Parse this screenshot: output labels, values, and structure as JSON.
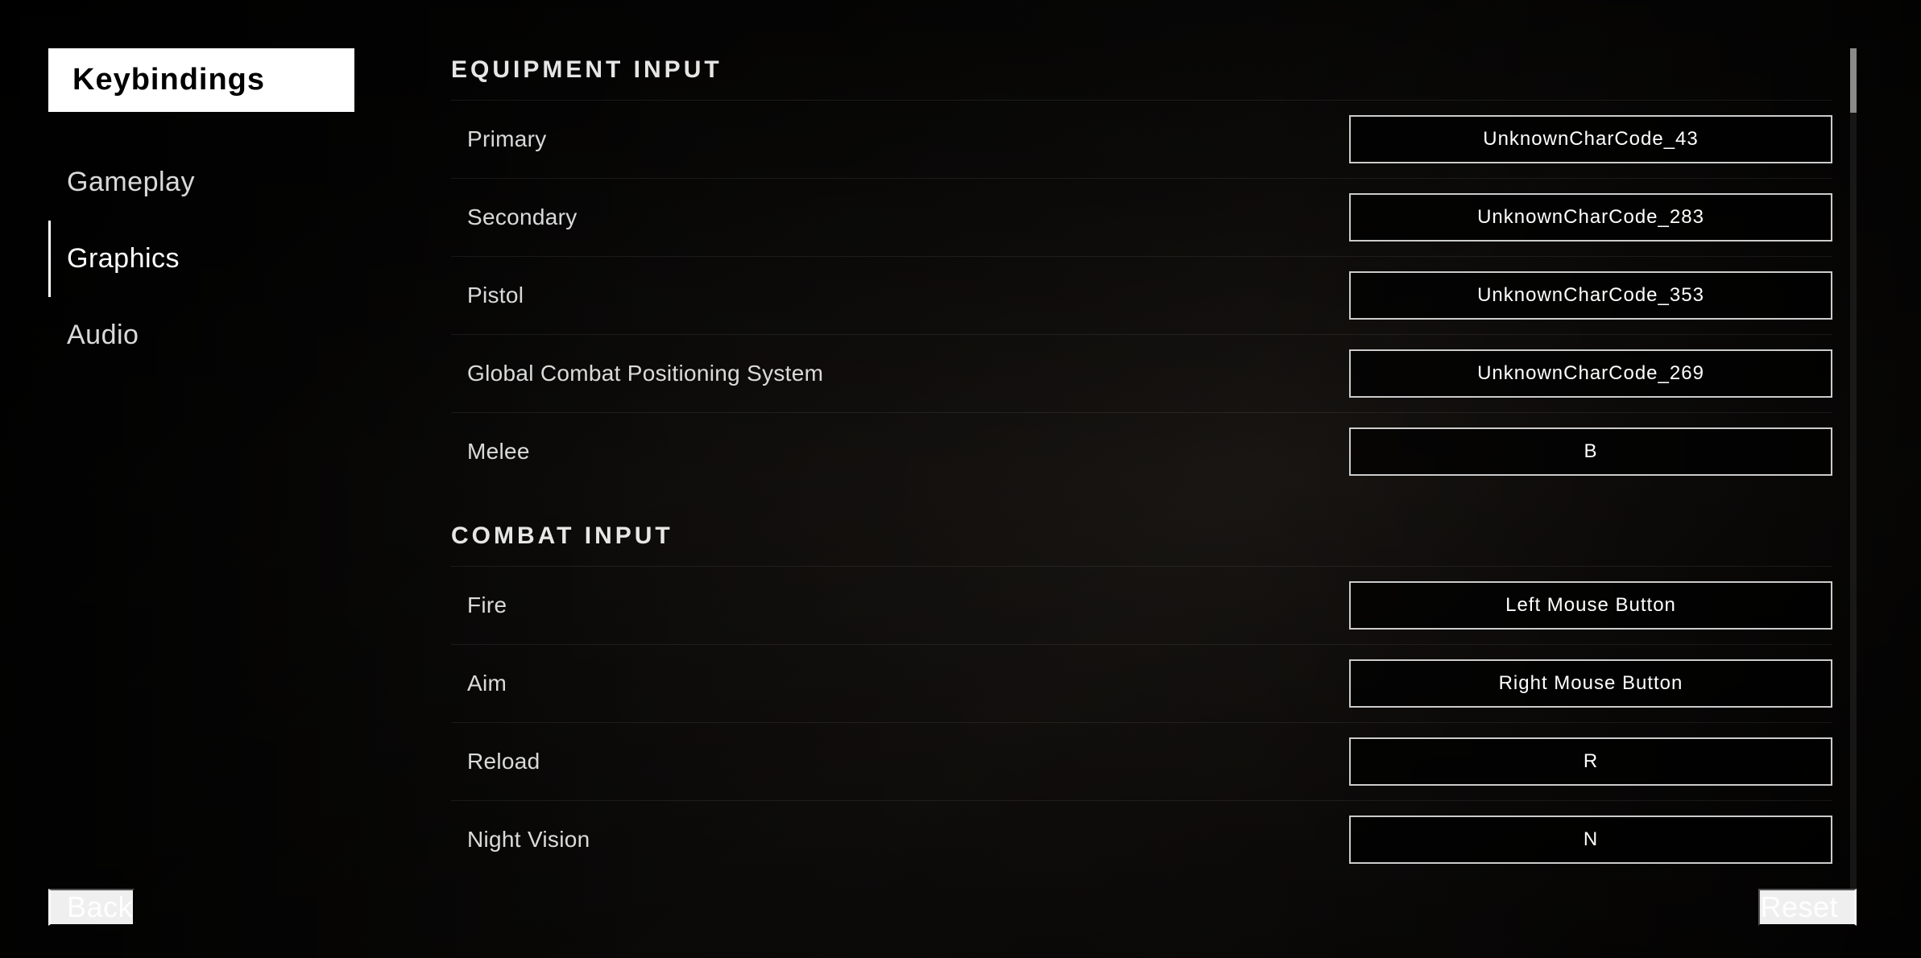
{
  "sidebar": {
    "title": "Keybindings",
    "items": [
      {
        "id": "gameplay",
        "label": "Gameplay",
        "active": false
      },
      {
        "id": "graphics",
        "label": "Graphics",
        "active": false
      },
      {
        "id": "audio",
        "label": "Audio",
        "active": false
      }
    ]
  },
  "equipment_section": {
    "title": "EQUIPMENT INPUT",
    "bindings": [
      {
        "id": "primary",
        "label": "Primary",
        "value": "UnknownCharCode_43"
      },
      {
        "id": "secondary",
        "label": "Secondary",
        "value": "UnknownCharCode_283"
      },
      {
        "id": "pistol",
        "label": "Pistol",
        "value": "UnknownCharCode_353"
      },
      {
        "id": "gcps",
        "label": "Global Combat Positioning System",
        "value": "UnknownCharCode_269"
      },
      {
        "id": "melee",
        "label": "Melee",
        "value": "B"
      }
    ]
  },
  "combat_section": {
    "title": "COMBAT INPUT",
    "bindings": [
      {
        "id": "fire",
        "label": "Fire",
        "value": "Left Mouse Button"
      },
      {
        "id": "aim",
        "label": "Aim",
        "value": "Right Mouse Button"
      },
      {
        "id": "reload",
        "label": "Reload",
        "value": "R"
      },
      {
        "id": "night_vision",
        "label": "Night Vision",
        "value": "N"
      }
    ]
  },
  "buttons": {
    "back": "Back",
    "reset": "Reset"
  }
}
